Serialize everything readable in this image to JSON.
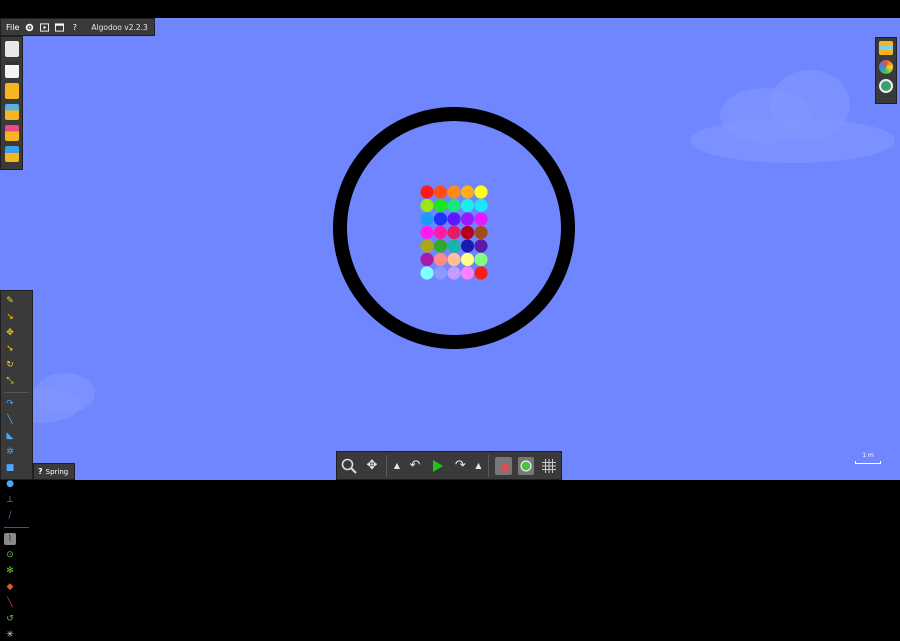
{
  "menu": {
    "file_label": "File",
    "version_label": "Algodoo v2.2.3"
  },
  "menu_icons": [
    "gear-icon",
    "play-icon",
    "window-icon",
    "help-icon"
  ],
  "left_toolbar_top": [
    "new-scene-icon",
    "blank-scene-icon",
    "open-folder-icon",
    "open-scene-icon",
    "browse-online-icon",
    "save-icon"
  ],
  "right_toolbar": [
    "layers-icon",
    "palette-icon",
    "plugin-icon"
  ],
  "spring_label": "Spring",
  "scale_label": "1 m",
  "scene": {
    "ring_color": "#000000",
    "ball_rows": [
      [
        "#ff1a1a",
        "#ff4d1a",
        "#ff8a1a",
        "#ffae1a",
        "#ffff1a"
      ],
      [
        "#99e61a",
        "#1ae61a",
        "#1ae680",
        "#1aeeee",
        "#1ae6ff"
      ],
      [
        "#1a9cff",
        "#1a33ff",
        "#5a1aff",
        "#9a1aff",
        "#e61aff"
      ],
      [
        "#ff1aee",
        "#ff1aaa",
        "#e61a66",
        "#b3001a",
        "#a54a1a"
      ],
      [
        "#a8a81a",
        "#2ea82e",
        "#1ab3a8",
        "#1a1ab3",
        "#5a1aa8"
      ],
      [
        "#a81aa8",
        "#ff8a8a",
        "#ffbf99",
        "#ffff80",
        "#80ff80"
      ],
      [
        "#80ffff",
        "#8a9bff",
        "#c49bff",
        "#ff80ff",
        "#ff1a1a"
      ]
    ]
  },
  "bottom_toolbar": [
    "zoom-icon",
    "pan-icon",
    "speed-up-arrow-icon",
    "undo-icon",
    "play-icon",
    "redo-icon",
    "speed-down-arrow-icon",
    "background-icon",
    "planet-icon",
    "grid-icon"
  ],
  "colors": {
    "background": "#6f86ff",
    "panel": "#3a3a3a",
    "play_green": "#1ec21e"
  }
}
